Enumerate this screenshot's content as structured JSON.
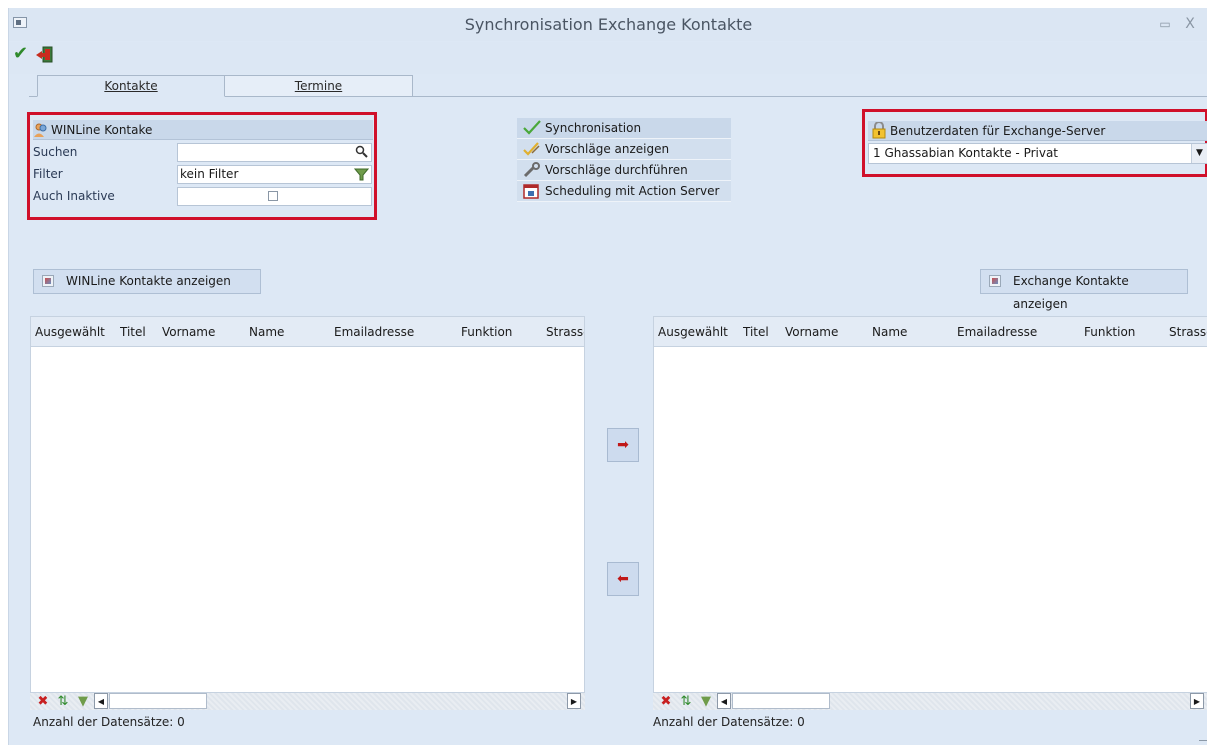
{
  "window": {
    "title": "Synchronisation Exchange Kontakte",
    "min_label": "▭",
    "close_label": "X"
  },
  "tabs": [
    {
      "label": "Kontakte"
    },
    {
      "label": "Termine"
    }
  ],
  "winline": {
    "header": "WINLine Kontake",
    "search_label": "Suchen",
    "search_value": "",
    "filter_label": "Filter",
    "filter_value": "kein Filter",
    "inactive_label": "Auch Inaktive",
    "inactive_checked": false
  },
  "sync": {
    "header": "Synchronisation",
    "items": [
      {
        "label": "Vorschläge anzeigen"
      },
      {
        "label": "Vorschläge durchführen"
      },
      {
        "label": "Scheduling mit Action Server"
      }
    ]
  },
  "exchange": {
    "header": "Benutzerdaten für Exchange-Server",
    "selected": "1  Ghassabian Kontakte - Privat"
  },
  "left_grid": {
    "show_button": "WINLine Kontakte anzeigen",
    "columns": [
      "Ausgewählt",
      "Titel",
      "Vorname",
      "Name",
      "Emailadresse",
      "Funktion",
      "Strasse"
    ],
    "count_text": "Anzahl der Datensätze:  0"
  },
  "right_grid": {
    "show_button": "Exchange Kontakte anzeigen",
    "columns": [
      "Ausgewählt",
      "Titel",
      "Vorname",
      "Name",
      "Emailadresse",
      "Funktion",
      "Strasse"
    ],
    "count_text": "Anzahl der Datensätze:  0"
  },
  "colors": {
    "accent_red": "#d0102a",
    "panel_bg": "#dde8f5",
    "header_bg": "#c9d8ea"
  }
}
